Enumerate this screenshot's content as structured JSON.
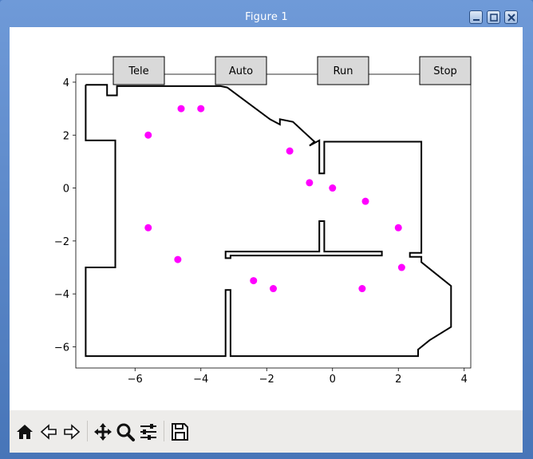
{
  "window": {
    "title": "Figure 1"
  },
  "window_controls": [
    "minimize-icon",
    "maximize-icon",
    "close-icon"
  ],
  "widgets": {
    "buttons": [
      "Tele",
      "Auto",
      "Run",
      "Stop"
    ]
  },
  "toolbar": {
    "icons": [
      "home-icon",
      "back-icon",
      "forward-icon",
      "pan-icon",
      "zoom-icon",
      "configure-subplots-icon",
      "save-icon"
    ]
  },
  "colors": {
    "points": "#ff00ff",
    "walls": "#000000",
    "button_bg": "#d9d9d9",
    "toolbar_bg": "#edecea"
  },
  "chart_data": {
    "type": "scatter",
    "title": "",
    "xlabel": "",
    "ylabel": "",
    "xlim": [
      -7.8,
      4.2
    ],
    "ylim": [
      -6.8,
      4.3
    ],
    "xticks": [
      -6,
      -4,
      -2,
      0,
      2,
      4
    ],
    "yticks": [
      -6,
      -4,
      -2,
      0,
      2,
      4
    ],
    "grid": false,
    "points": [
      {
        "x": -4.6,
        "y": 3.0
      },
      {
        "x": -4.0,
        "y": 3.0
      },
      {
        "x": -5.6,
        "y": 2.0
      },
      {
        "x": -1.3,
        "y": 1.4
      },
      {
        "x": -0.7,
        "y": 0.2
      },
      {
        "x": 0.0,
        "y": 0.0
      },
      {
        "x": 1.0,
        "y": -0.5
      },
      {
        "x": 2.0,
        "y": -1.5
      },
      {
        "x": -5.6,
        "y": -1.5
      },
      {
        "x": -4.7,
        "y": -2.7
      },
      {
        "x": 2.1,
        "y": -3.0
      },
      {
        "x": -2.4,
        "y": -3.5
      },
      {
        "x": -1.8,
        "y": -3.8
      },
      {
        "x": 0.9,
        "y": -3.8
      }
    ],
    "walls": [
      [
        [
          -7.5,
          3.9
        ],
        [
          -7.5,
          1.8
        ],
        [
          -6.6,
          1.8
        ],
        [
          -6.6,
          -3.0
        ],
        [
          -7.5,
          -3.0
        ],
        [
          -7.5,
          -6.35
        ],
        [
          -3.25,
          -6.35
        ],
        [
          -3.25,
          -3.85
        ],
        [
          -3.1,
          -3.85
        ],
        [
          -3.1,
          -6.35
        ],
        [
          2.6,
          -6.35
        ],
        [
          2.6,
          -6.1
        ],
        [
          2.95,
          -5.75
        ],
        [
          3.6,
          -5.25
        ],
        [
          3.6,
          -3.7
        ],
        [
          2.95,
          -3.05
        ],
        [
          2.7,
          -2.8
        ],
        [
          2.7,
          -2.6
        ],
        [
          2.35,
          -2.6
        ],
        [
          2.35,
          -2.45
        ],
        [
          2.7,
          -2.45
        ],
        [
          2.7,
          1.75
        ],
        [
          -0.25,
          1.75
        ],
        [
          -0.25,
          0.55
        ],
        [
          -0.4,
          0.55
        ],
        [
          -0.4,
          1.8
        ],
        [
          -0.7,
          1.6
        ],
        [
          -0.55,
          1.75
        ],
        [
          -1.2,
          2.5
        ],
        [
          -1.6,
          2.6
        ],
        [
          -1.6,
          2.4
        ],
        [
          -1.9,
          2.6
        ],
        [
          -3.2,
          3.8
        ],
        [
          -3.4,
          3.85
        ],
        [
          -6.55,
          3.85
        ],
        [
          -6.55,
          3.5
        ],
        [
          -6.85,
          3.5
        ],
        [
          -6.85,
          3.9
        ],
        [
          -7.5,
          3.9
        ]
      ],
      [
        [
          -3.25,
          -2.45
        ],
        [
          -3.25,
          -2.65
        ],
        [
          -3.1,
          -2.65
        ],
        [
          -3.1,
          -2.55
        ],
        [
          1.5,
          -2.55
        ],
        [
          1.5,
          -2.4
        ],
        [
          -0.25,
          -2.4
        ],
        [
          -0.25,
          -1.25
        ],
        [
          -0.4,
          -1.25
        ],
        [
          -0.4,
          -2.4
        ],
        [
          -3.25,
          -2.4
        ],
        [
          -3.25,
          -2.45
        ]
      ]
    ]
  }
}
